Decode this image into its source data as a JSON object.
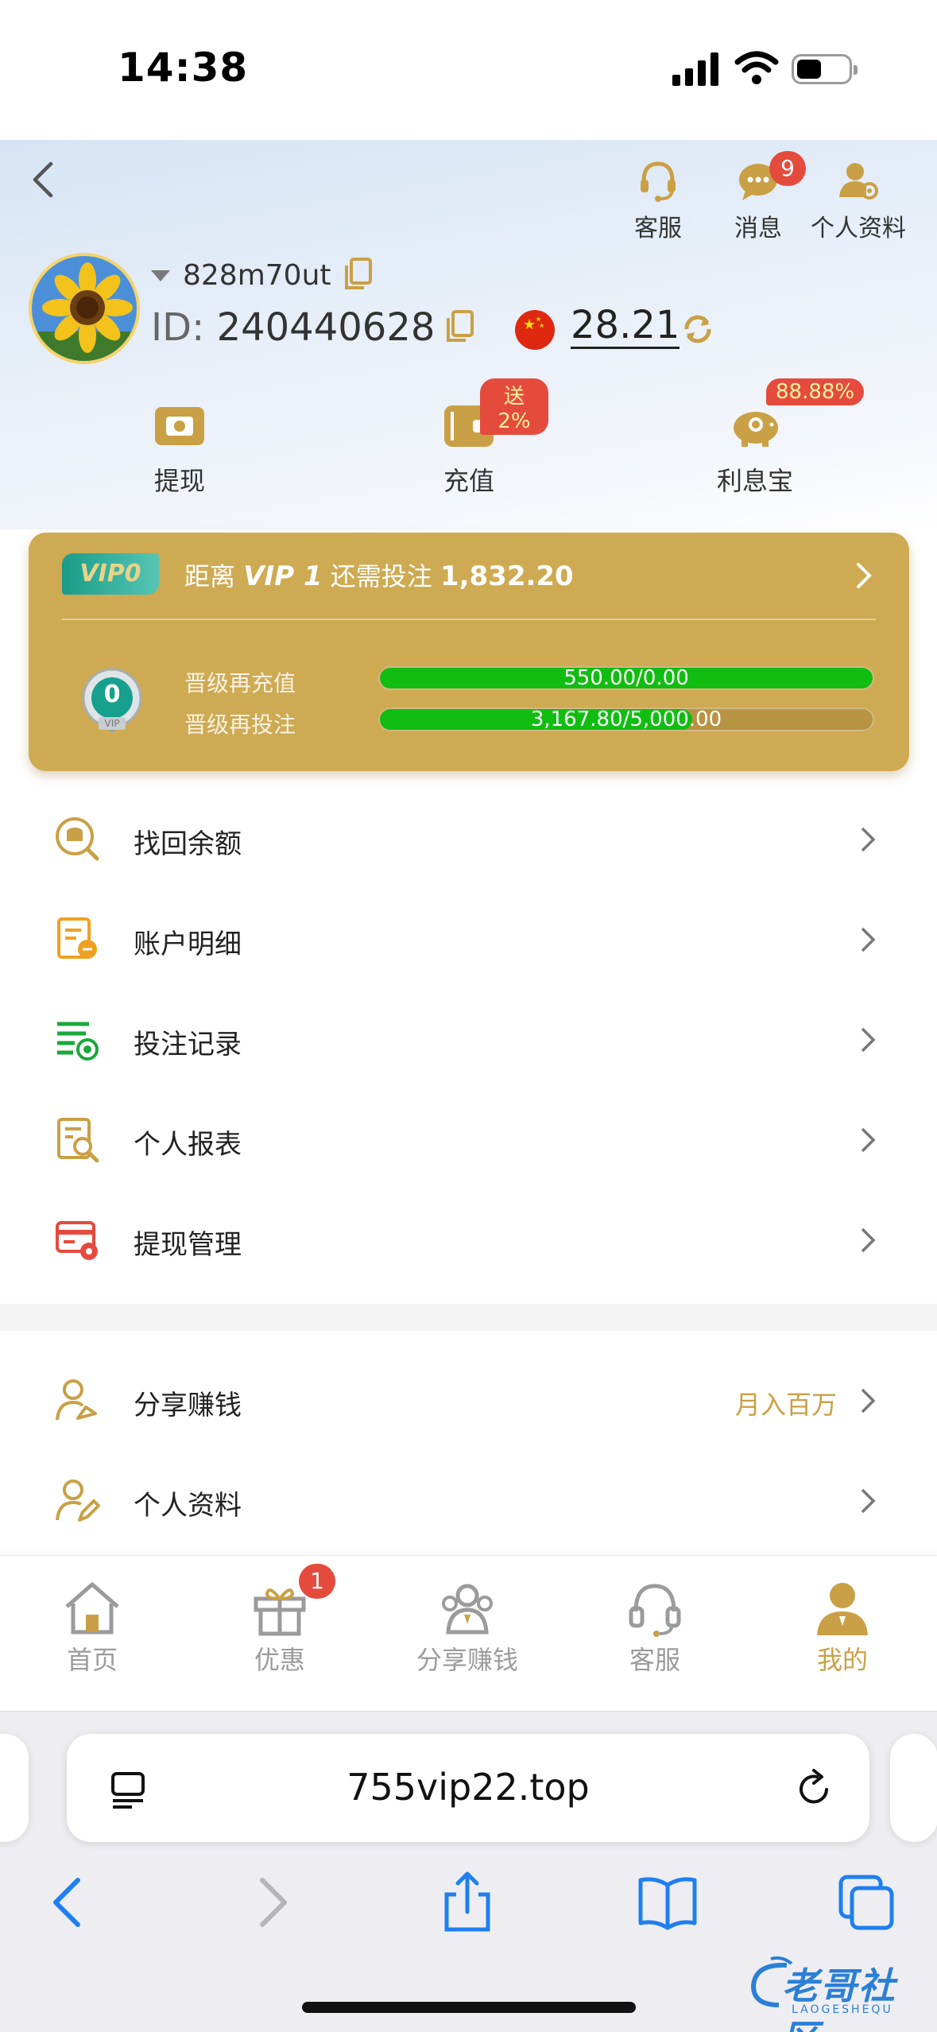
{
  "status_bar": {
    "time": "14:38"
  },
  "header": {
    "icons": [
      {
        "label": "客服",
        "icon": "headset-icon"
      },
      {
        "label": "消息",
        "icon": "chat-icon",
        "badge": "9"
      },
      {
        "label": "个人资料",
        "icon": "user-settings-icon"
      }
    ],
    "username": "828m70ut",
    "id_prefix": "ID:",
    "id_value": "240440628",
    "balance": "28.21",
    "quick_actions": [
      {
        "label": "提现",
        "icon": "withdraw-icon"
      },
      {
        "label": "充值",
        "icon": "wallet-icon",
        "tag": "送2%"
      },
      {
        "label": "利息宝",
        "icon": "piggy-bank-icon",
        "tag": "88.88%"
      }
    ]
  },
  "vip_card": {
    "level_pill": "VIP0",
    "medal_number": "0",
    "medal_caption": "VIP",
    "distance_prefix": "距离",
    "next_level": "VIP 1",
    "distance_mid": "还需投注",
    "distance_amount": "1,832.20",
    "progress": [
      {
        "label": "晋级再充值",
        "text": "550.00/0.00",
        "fraction": 1.0
      },
      {
        "label": "晋级再投注",
        "text": "3,167.80/5,000.00",
        "fraction": 0.6336
      }
    ]
  },
  "menu_group_1": [
    {
      "label": "找回余额",
      "icon": "coin-search-icon"
    },
    {
      "label": "账户明细",
      "icon": "account-detail-icon"
    },
    {
      "label": "投注记录",
      "icon": "bet-record-icon"
    },
    {
      "label": "个人报表",
      "icon": "report-search-icon"
    },
    {
      "label": "提现管理",
      "icon": "card-settings-icon"
    }
  ],
  "menu_group_2": [
    {
      "label": "分享赚钱",
      "icon": "user-share-icon",
      "right_text": "月入百万"
    },
    {
      "label": "个人资料",
      "icon": "user-edit-icon"
    }
  ],
  "tab_bar": [
    {
      "label": "首页",
      "icon": "home-icon"
    },
    {
      "label": "优惠",
      "icon": "gift-icon",
      "badge": "1"
    },
    {
      "label": "分享赚钱",
      "icon": "share-earn-icon"
    },
    {
      "label": "客服",
      "icon": "headset-icon"
    },
    {
      "label": "我的",
      "icon": "person-icon",
      "active": true
    }
  ],
  "browser": {
    "url": "755vip22.top"
  },
  "watermark": {
    "text": "老哥社区",
    "sub": "LAOGESHEQU"
  },
  "colors": {
    "gold": "#ceaa52",
    "accent_text": "#c9a045",
    "badge_red": "#e54b3d",
    "progress_green": "#11bd11"
  }
}
